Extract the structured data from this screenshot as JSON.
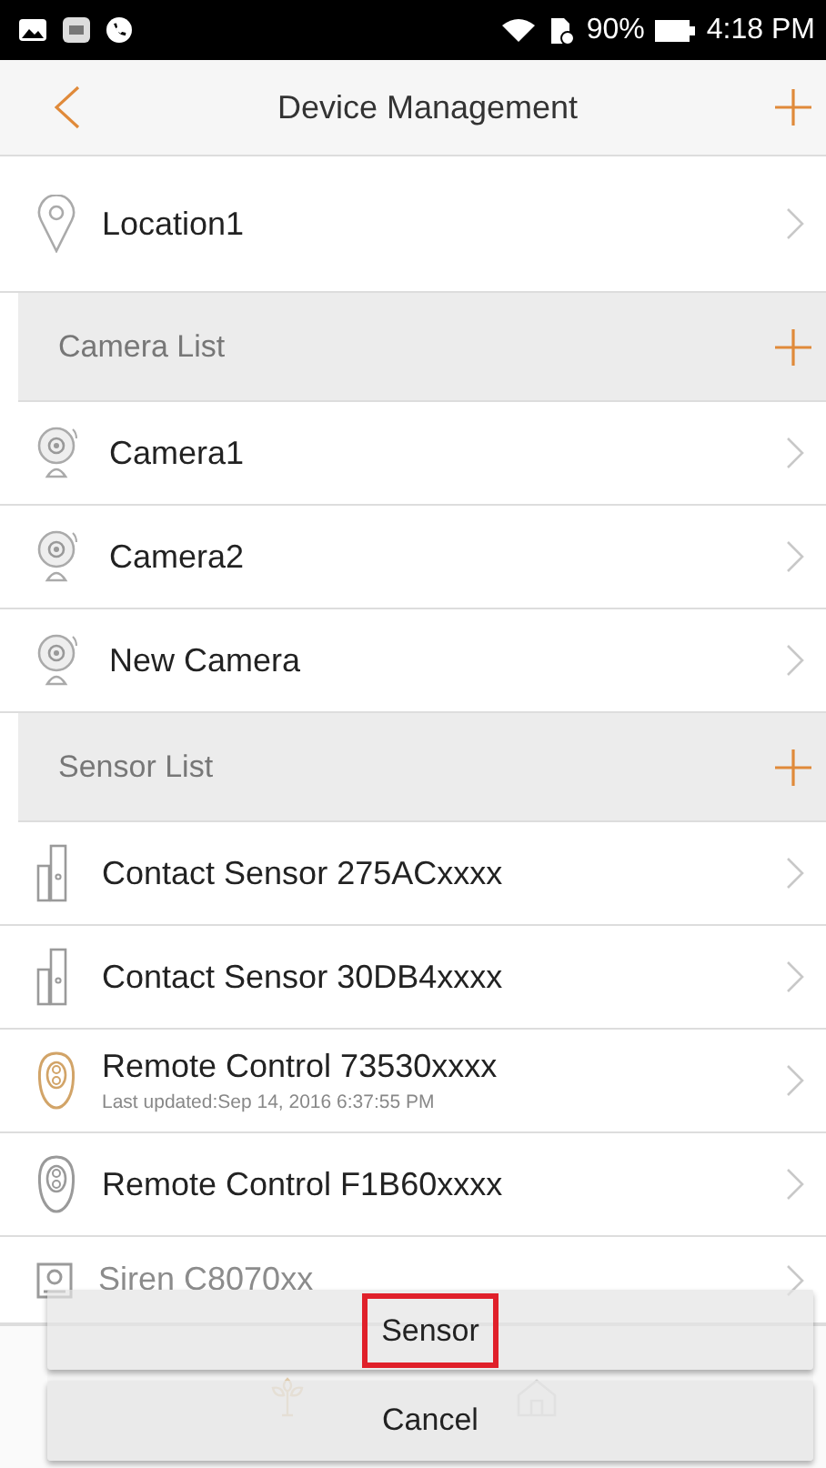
{
  "status_bar": {
    "battery": "90%",
    "time": "4:18 PM"
  },
  "header": {
    "title": "Device Management"
  },
  "location": {
    "name": "Location1"
  },
  "camera_list": {
    "title": "Camera List",
    "items": [
      {
        "name": "Camera1"
      },
      {
        "name": "Camera2"
      },
      {
        "name": "New Camera"
      }
    ]
  },
  "sensor_list": {
    "title": "Sensor List",
    "items": [
      {
        "kind": "contact",
        "name": "Contact Sensor 275ACxxxx",
        "color": "#9a9a9a"
      },
      {
        "kind": "contact",
        "name": "Contact Sensor 30DB4xxxx",
        "color": "#9a9a9a"
      },
      {
        "kind": "remote",
        "name": "Remote Control 73530xxxx",
        "subtitle": "Last updated:Sep 14, 2016 6:37:55 PM",
        "color": "#d2a468"
      },
      {
        "kind": "remote",
        "name": "Remote Control F1B60xxxx",
        "color": "#9a9a9a"
      },
      {
        "kind": "siren",
        "name": "Siren C8070xx",
        "color": "#9a9a9a"
      }
    ]
  },
  "action_sheet": {
    "options": [
      {
        "label": "Sensor",
        "highlighted": true
      }
    ],
    "cancel": "Cancel"
  }
}
